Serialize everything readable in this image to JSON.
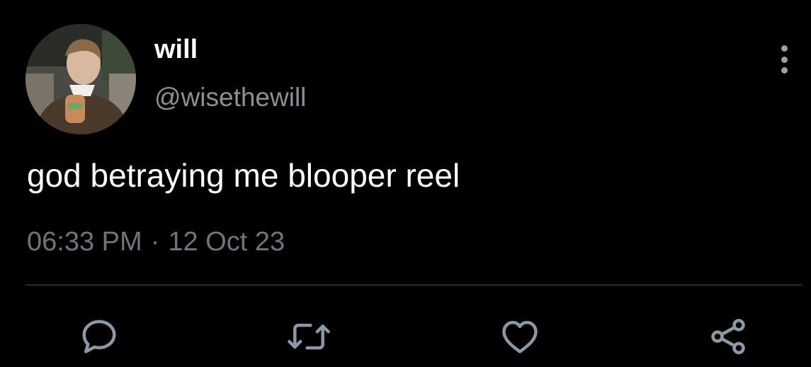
{
  "tweet": {
    "author": {
      "display_name": "will",
      "handle": "@wisethewill"
    },
    "text": "god betraying me blooper reel",
    "time": "06:33 PM",
    "separator": "·",
    "date": "12 Oct 23"
  },
  "actions": {
    "reply_icon": "reply-icon",
    "retweet_icon": "retweet-icon",
    "like_icon": "heart-icon",
    "share_icon": "share-icon",
    "more_icon": "more-vertical-icon"
  },
  "colors": {
    "background": "#000000",
    "primary_text": "#ffffff",
    "secondary_text": "#6e767d",
    "icon": "#8b98a5",
    "divider": "#2a2d30"
  }
}
